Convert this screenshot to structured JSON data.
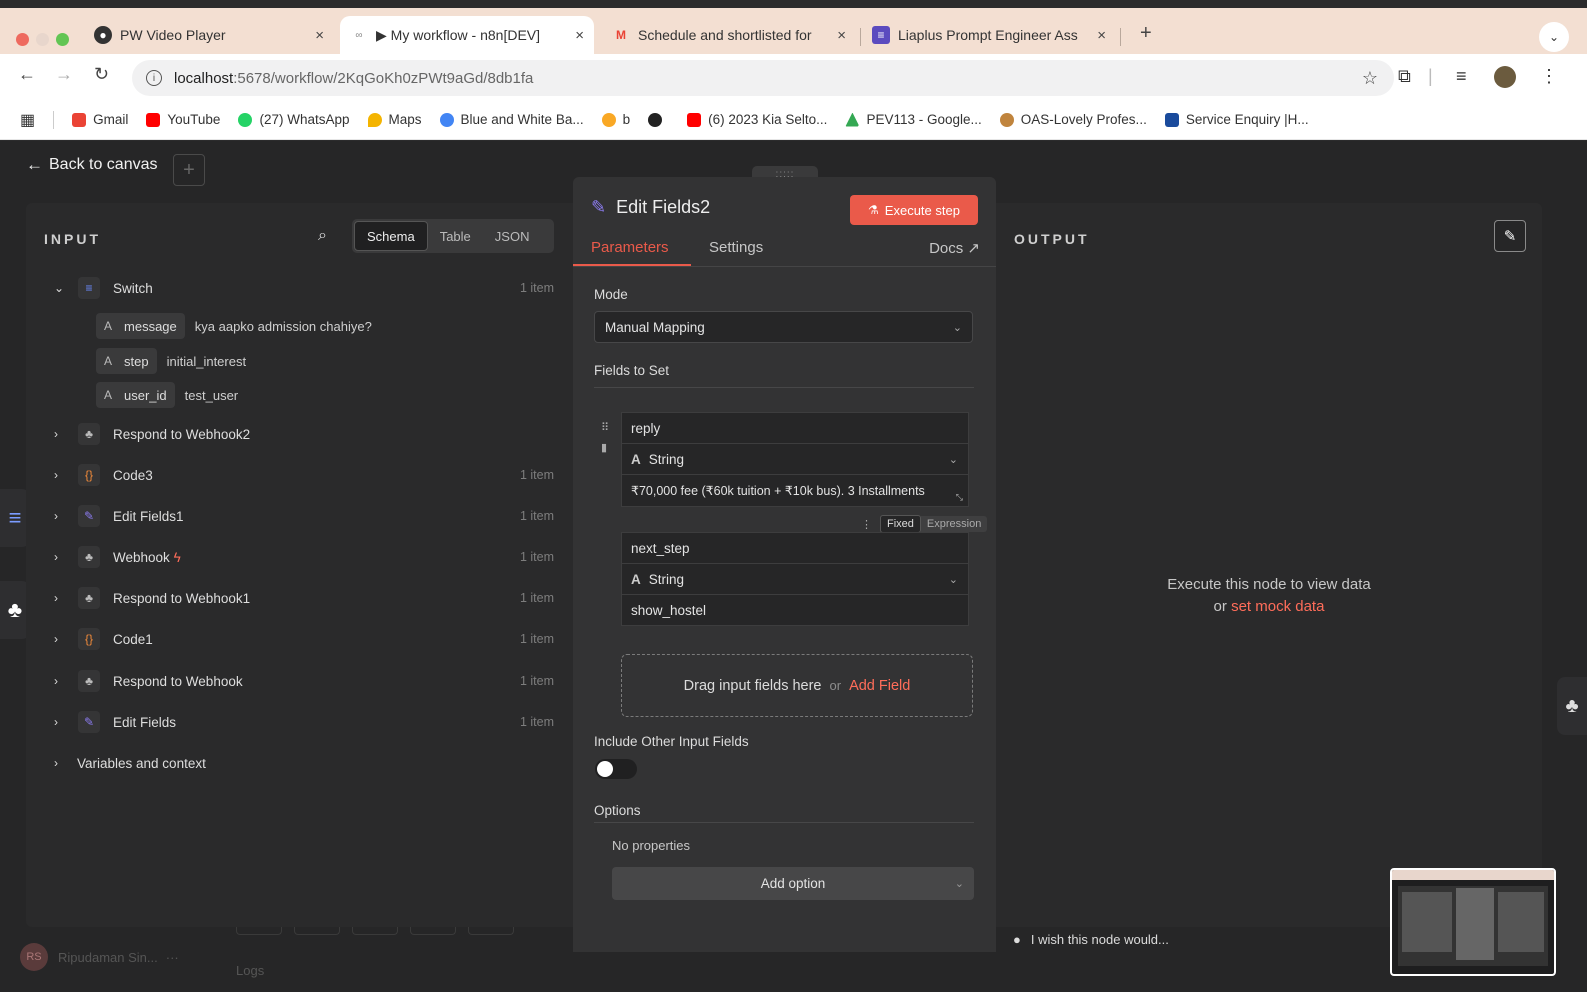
{
  "browser": {
    "tabs": [
      {
        "title": "PW Video Player",
        "close": "×"
      },
      {
        "title": "▶ My workflow - n8n[DEV]",
        "close": "×"
      },
      {
        "title": "Schedule and shortlisted for",
        "close": "×"
      },
      {
        "title": "Liaplus Prompt Engineer Ass",
        "close": "×"
      }
    ],
    "new_tab": "+",
    "url_host": "localhost",
    "url_path": ":5678/workflow/2KqGoKh0zPWt9aGd/8db1fa",
    "bookmarks": [
      {
        "label": "Gmail",
        "color": "#ea4335"
      },
      {
        "label": "YouTube",
        "color": "#ff0000"
      },
      {
        "label": "(27) WhatsApp",
        "color": "#25d366"
      },
      {
        "label": "Maps",
        "color": "#f4b400"
      },
      {
        "label": "Blue and White Ba...",
        "color": "#4285f4"
      },
      {
        "label": "b",
        "color": "#f9a825"
      },
      {
        "label": "",
        "color": "#222222"
      },
      {
        "label": "(6) 2023 Kia Selto...",
        "color": "#ff0000"
      },
      {
        "label": "PEV113 - Google...",
        "color": "#34a853"
      },
      {
        "label": "OAS-Lovely Profes...",
        "color": "#c0843d"
      },
      {
        "label": "Service Enquiry |H...",
        "color": "#1a4b9c"
      }
    ]
  },
  "app": {
    "back_label": "Back to canvas",
    "user_initials": "RS",
    "user_name": "Ripudaman Sin...",
    "logs_label": "Logs"
  },
  "input": {
    "title": "INPUT",
    "view_tabs": [
      "Schema",
      "Table",
      "JSON"
    ],
    "nodes": [
      {
        "name": "Switch",
        "count": "1 item",
        "expanded": true,
        "icon": "≡",
        "icon_color": "#6b8cff"
      },
      {
        "name": "Respond to Webhook2",
        "count": "",
        "icon": "♣",
        "icon_color": "#bbbbbb"
      },
      {
        "name": "Code3",
        "count": "1 item",
        "icon": "{}",
        "icon_color": "#f08a3a"
      },
      {
        "name": "Edit Fields1",
        "count": "1 item",
        "icon": "✎",
        "icon_color": "#8c7cf0"
      },
      {
        "name": "Webhook",
        "count": "1 item",
        "icon": "♣",
        "icon_color": "#bbbbbb"
      },
      {
        "name": "Respond to Webhook1",
        "count": "1 item",
        "icon": "♣",
        "icon_color": "#bbbbbb"
      },
      {
        "name": "Code1",
        "count": "1 item",
        "icon": "{}",
        "icon_color": "#f08a3a"
      },
      {
        "name": "Respond to Webhook",
        "count": "1 item",
        "icon": "♣",
        "icon_color": "#bbbbbb"
      },
      {
        "name": "Edit Fields",
        "count": "1 item",
        "icon": "✎",
        "icon_color": "#8c7cf0"
      }
    ],
    "switch_fields": [
      {
        "type": "A",
        "key": "message",
        "value": "kya aapko admission chahiye?"
      },
      {
        "type": "A",
        "key": "step",
        "value": "initial_interest"
      },
      {
        "type": "A",
        "key": "user_id",
        "value": "test_user"
      }
    ],
    "variables_label": "Variables and context"
  },
  "edit": {
    "title": "Edit Fields2",
    "execute_label": "Execute step",
    "tabs": [
      "Parameters",
      "Settings"
    ],
    "docs_label": "Docs",
    "mode_label": "Mode",
    "mode_value": "Manual Mapping",
    "fields_label": "Fields to Set",
    "fields": [
      {
        "name": "reply",
        "type": "String",
        "value": "₹70,000 fee (₹60k tuition + ₹10k bus). 3 Installments"
      },
      {
        "name": "next_step",
        "type": "String",
        "value": "show_hostel"
      }
    ],
    "fixed_label": "Fixed",
    "expression_label": "Expression",
    "drop_text": "Drag input fields here",
    "drop_or": "or",
    "add_field": "Add Field",
    "include_label": "Include Other Input Fields",
    "options_label": "Options",
    "no_props": "No properties",
    "add_option": "Add option"
  },
  "output": {
    "title": "OUTPUT",
    "empty_line1": "Execute this node to view data",
    "empty_or": "or",
    "mock_link": "set mock data",
    "wish_text": "I wish this node would..."
  }
}
